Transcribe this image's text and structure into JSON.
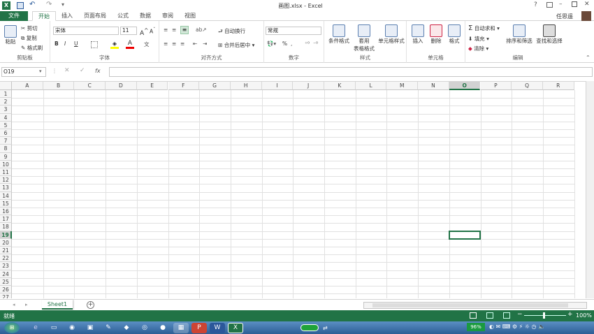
{
  "window": {
    "title": "画图.xlsx - Excel",
    "help": "?",
    "user": "任思遥"
  },
  "qat": {
    "save_icon": "save-icon",
    "undo_icon": "undo-icon",
    "redo_icon": "redo-icon"
  },
  "tabs": [
    {
      "label": "文件"
    },
    {
      "label": "开始"
    },
    {
      "label": "插入"
    },
    {
      "label": "页面布局"
    },
    {
      "label": "公式"
    },
    {
      "label": "数据"
    },
    {
      "label": "审阅"
    },
    {
      "label": "视图"
    }
  ],
  "ribbon": {
    "clipboard": {
      "label": "剪贴板",
      "paste": "粘贴",
      "cut": "剪切",
      "copy": "复制",
      "format_painter": "格式刷"
    },
    "font": {
      "label": "字体",
      "name": "宋体",
      "size": "11",
      "bold": "B",
      "italic": "I",
      "underline": "U"
    },
    "alignment": {
      "label": "对齐方式",
      "wrap": "自动换行",
      "merge": "合并后居中"
    },
    "number": {
      "label": "数字",
      "format": "常规",
      "percent": "%"
    },
    "styles": {
      "label": "样式",
      "conditional": "条件格式",
      "table_line1": "套用",
      "table_line2": "表格格式",
      "cell_styles": "单元格样式"
    },
    "cells": {
      "label": "单元格",
      "insert": "插入",
      "delete": "删除",
      "format": "格式"
    },
    "editing": {
      "label": "编辑",
      "autosum": "自动求和",
      "fill": "填充",
      "clear": "清除",
      "sort": "排序和筛选",
      "find": "查找和选择"
    }
  },
  "formula": {
    "namebox": "O19",
    "fx": "fx",
    "value": ""
  },
  "grid": {
    "columns": [
      "A",
      "B",
      "C",
      "D",
      "E",
      "F",
      "G",
      "H",
      "I",
      "J",
      "K",
      "L",
      "M",
      "N",
      "O",
      "P",
      "Q",
      "R"
    ],
    "rows": [
      "1",
      "2",
      "3",
      "4",
      "5",
      "6",
      "7",
      "8",
      "9",
      "10",
      "11",
      "12",
      "13",
      "14",
      "15",
      "16",
      "17",
      "18",
      "19",
      "20",
      "21",
      "22",
      "23",
      "24",
      "25",
      "26",
      "27"
    ],
    "selected_col": "O",
    "selected_row": "19"
  },
  "sheets": {
    "tabs": [
      {
        "label": "Sheet1"
      }
    ],
    "add": "+"
  },
  "status": {
    "ready": "就绪",
    "zoom": "100%",
    "minus": "−",
    "plus": "+"
  },
  "taskbar": {
    "battery": "96%"
  }
}
